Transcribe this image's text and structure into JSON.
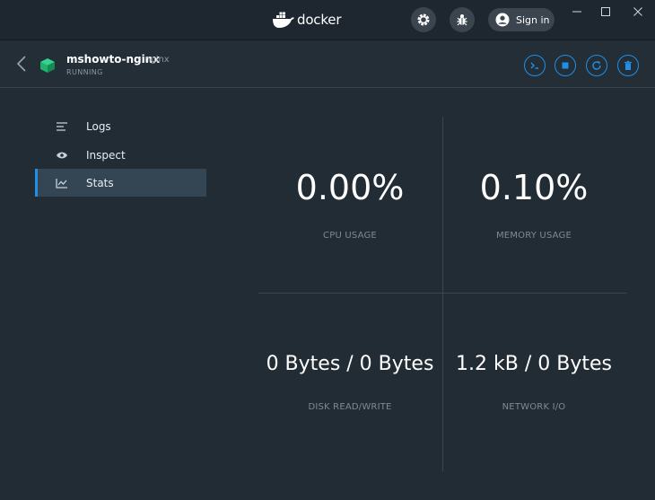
{
  "app": {
    "brand": "docker"
  },
  "titlebar": {
    "signin_label": "Sign in"
  },
  "container": {
    "name": "mshowto-nginx",
    "image": "nginx",
    "status": "RUNNING"
  },
  "sidebar": {
    "items": [
      {
        "label": "Logs",
        "icon": "logs-icon",
        "active": false
      },
      {
        "label": "Inspect",
        "icon": "eye-icon",
        "active": false
      },
      {
        "label": "Stats",
        "icon": "chart-icon",
        "active": true
      }
    ]
  },
  "stats": {
    "cpu": {
      "value": "0.00%",
      "label": "CPU USAGE"
    },
    "memory": {
      "value": "0.10%",
      "label": "MEMORY USAGE"
    },
    "disk": {
      "value": "0 Bytes / 0 Bytes",
      "label": "DISK READ/WRITE"
    },
    "network": {
      "value": "1.2 kB / 0 Bytes",
      "label": "NETWORK I/O"
    }
  },
  "colors": {
    "accent": "#1f8fe8",
    "background": "#222c35",
    "running": "#1fb46e"
  }
}
